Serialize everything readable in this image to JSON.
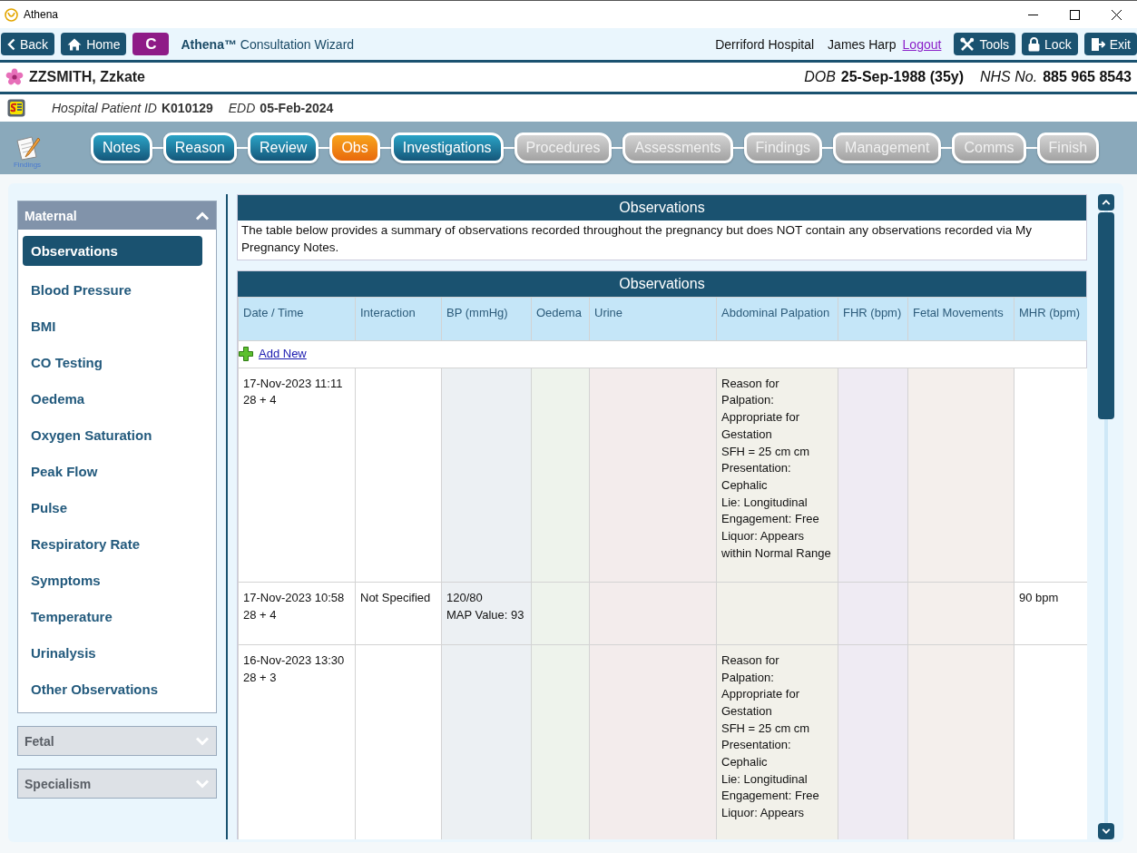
{
  "window": {
    "title": "Athena"
  },
  "toolbar": {
    "nav_buttons": [
      {
        "label": "Back"
      },
      {
        "label": "Home"
      }
    ],
    "badge": "C",
    "app_title": "**Athena™** Consultation Wizard",
    "location": "Derriford Hospital",
    "user": "James Harp",
    "logout": "Logout",
    "actions": [
      {
        "label": "Tools"
      },
      {
        "label": "Lock"
      },
      {
        "label": "Exit"
      }
    ]
  },
  "patient": {
    "name": "ZZSMITH, Zzkate",
    "dob_label": "DOB",
    "dob": "25-Sep-1988 (35y)",
    "nhs_label": "NHS No.",
    "nhs": "885 965 8543",
    "id_label": "Hospital Patient ID",
    "id": "K010129",
    "edd_label": "EDD",
    "edd": "05-Feb-2024"
  },
  "wizard": {
    "icon_label": "Findings",
    "steps": [
      {
        "label": "Notes",
        "selected": false,
        "disabled": false
      },
      {
        "label": "Reason",
        "selected": false,
        "disabled": false
      },
      {
        "label": "Review",
        "selected": false,
        "disabled": false
      },
      {
        "label": "Obs",
        "selected": true,
        "disabled": false
      },
      {
        "label": "Investigations",
        "selected": false,
        "disabled": false
      },
      {
        "label": "Procedures",
        "selected": false,
        "disabled": true
      },
      {
        "label": "Assessments",
        "selected": false,
        "disabled": true
      },
      {
        "label": "Findings",
        "selected": false,
        "disabled": true
      },
      {
        "label": "Management",
        "selected": false,
        "disabled": true
      },
      {
        "label": "Comms",
        "selected": false,
        "disabled": true
      },
      {
        "label": "Finish",
        "selected": false,
        "disabled": true
      }
    ]
  },
  "sidebar": {
    "sections": [
      {
        "title": "Maternal",
        "expanded": true,
        "items": [
          {
            "label": "Observations",
            "selected": true
          },
          {
            "label": "Blood Pressure",
            "selected": false
          },
          {
            "label": "BMI",
            "selected": false
          },
          {
            "label": "CO Testing",
            "selected": false
          },
          {
            "label": "Oedema",
            "selected": false
          },
          {
            "label": "Oxygen Saturation",
            "selected": false
          },
          {
            "label": "Peak Flow",
            "selected": false
          },
          {
            "label": "Pulse",
            "selected": false
          },
          {
            "label": "Respiratory Rate",
            "selected": false
          },
          {
            "label": "Symptoms",
            "selected": false
          },
          {
            "label": "Temperature",
            "selected": false
          },
          {
            "label": "Urinalysis",
            "selected": false
          },
          {
            "label": "Other Observations",
            "selected": false
          }
        ]
      },
      {
        "title": "Fetal",
        "expanded": false
      },
      {
        "title": "Specialism",
        "expanded": false
      }
    ]
  },
  "summary": {
    "title": "Observations",
    "text": "The table below provides a summary of observations recorded throughout the pregnancy but does NOT contain any observations recorded via My Pregnancy Notes."
  },
  "table": {
    "title": "Observations",
    "columns": [
      "Date / Time",
      "Interaction",
      "BP (mmHg)",
      "Oedema",
      "Urine",
      "Abdominal Palpation",
      "FHR (bpm)",
      "Fetal Movements",
      "MHR (bpm)"
    ],
    "add_new": "Add New",
    "rows": [
      {
        "cells": [
          "17-Nov-2023 11:11\n28 + 4",
          null,
          null,
          null,
          null,
          "Reason for Palpation: Appropriate for Gestation\nSFH = 25 cm cm\nPresentation: Cephalic\nLie: Longitudinal\nEngagement: Free\nLiquor: Appears within Normal Range",
          null,
          null,
          null
        ]
      },
      {
        "cells": [
          "17-Nov-2023 10:58\n28 + 4",
          "Not Specified",
          "120/80\nMAP Value: 93",
          null,
          null,
          null,
          null,
          null,
          "90 bpm"
        ]
      },
      {
        "cells": [
          "16-Nov-2023 13:30\n28 + 3",
          null,
          null,
          null,
          null,
          "Reason for Palpation: Appropriate for Gestation\nSFH = 25 cm cm\nPresentation: Cephalic\nLie: Longitudinal\nEngagement: Free\nLiquor: Appears",
          null,
          null,
          null
        ]
      }
    ]
  }
}
